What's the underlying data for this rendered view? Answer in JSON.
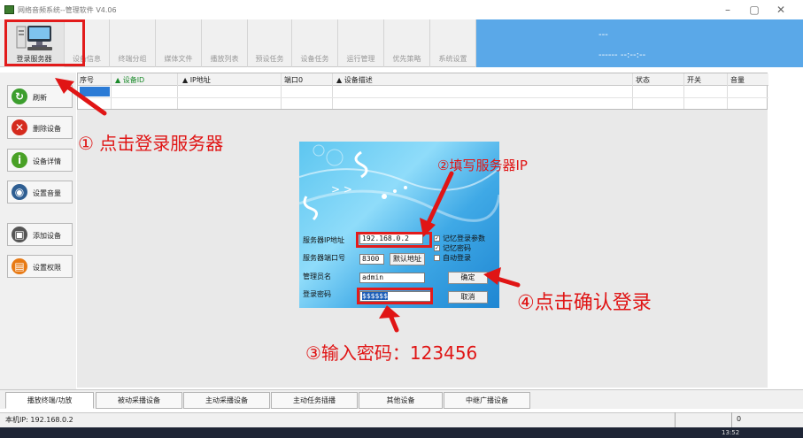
{
  "window": {
    "title": "网络音频系统--管理软件  V4.06",
    "buttons": {
      "minimize": "–",
      "maximize": "▢",
      "close": "✕"
    }
  },
  "toolbar": {
    "items": [
      {
        "label": "登录服务器"
      },
      {
        "label": "设备信息"
      },
      {
        "label": "终端分组"
      },
      {
        "label": "媒体文件"
      },
      {
        "label": "播放列表"
      },
      {
        "label": "预设任务"
      },
      {
        "label": "设备任务"
      },
      {
        "label": "运行管理"
      },
      {
        "label": "优先策略"
      },
      {
        "label": "系统设置"
      }
    ],
    "clock_top": "---",
    "clock_bottom": "------  --:--:--"
  },
  "sidebar": {
    "items": [
      {
        "label": "刷新",
        "icon": "refresh-icon",
        "color": "#3c9e2e",
        "glyph": "↻"
      },
      {
        "label": "删除设备",
        "icon": "delete-icon",
        "color": "#d52b1e",
        "glyph": "✕"
      },
      {
        "label": "设备详情",
        "icon": "info-icon",
        "color": "#49a126",
        "glyph": "i"
      },
      {
        "label": "设置音量",
        "icon": "volume-icon",
        "color": "#2e5e92",
        "glyph": "◉"
      },
      {
        "label": "添加设备",
        "icon": "speaker-icon",
        "color": "#555555",
        "glyph": "▣"
      },
      {
        "label": "设置权限",
        "icon": "permission-icon",
        "color": "#e87a14",
        "glyph": "▤"
      }
    ]
  },
  "table": {
    "columns": [
      "序号",
      "▲  设备ID",
      "▲  IP地址",
      "端口0",
      "▲  设备描述",
      "状态",
      "开关",
      "音量"
    ]
  },
  "tabs": [
    "播放终端/功放",
    "被动采播设备",
    "主动采播设备",
    "主动任务插播",
    "其他设备",
    "中继广播设备"
  ],
  "status": {
    "ip": "本机IP: 192.168.0.2",
    "count": "0"
  },
  "taskbar": {
    "time": "13:52"
  },
  "dialog": {
    "labels": {
      "server_ip": "服务器IP地址",
      "server_port": "服务器端口号",
      "admin": "管理员名",
      "password": "登录密码"
    },
    "values": {
      "server_ip": "192.168.0.2",
      "server_port": "8300",
      "admin": "admin",
      "password": "$$$$$$"
    },
    "buttons": {
      "default_addr": "默认地址",
      "ok": "确定",
      "cancel": "取消"
    },
    "checks": [
      {
        "label": "记忆登录参数",
        "checked": true
      },
      {
        "label": "记忆密码",
        "checked": true
      },
      {
        "label": "自动登录",
        "checked": false
      }
    ]
  },
  "annotations": {
    "step1": "① 点击登录服务器",
    "step2": "②填写服务器IP",
    "step3": "③输入密码：123456",
    "step4": "④点击确认登录"
  },
  "colors": {
    "annotation_red": "#e01515",
    "blue_panel": "#5aa8e8",
    "selection": "#2b7bd6"
  }
}
